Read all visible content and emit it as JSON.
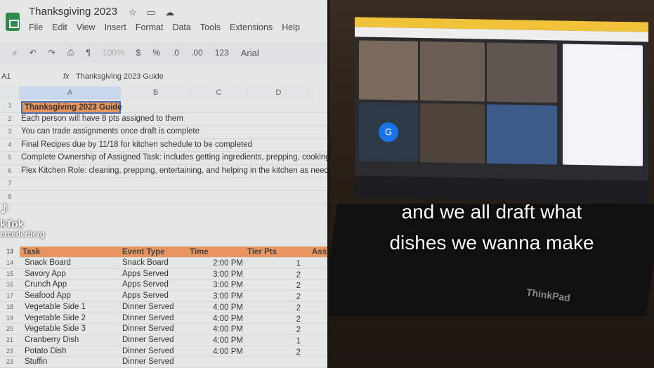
{
  "sheet": {
    "title": "Thanksgiving 2023",
    "menu": [
      "File",
      "Edit",
      "View",
      "Insert",
      "Format",
      "Data",
      "Tools",
      "Extensions",
      "Help"
    ],
    "toolbar": {
      "zoom": "100%",
      "currency": "$",
      "percent": "%",
      "dec_less": ".0",
      "dec_more": ".00",
      "format": "123",
      "font": "Arial"
    },
    "cell_ref": "A1",
    "fx": "fx",
    "formula": "Thanksgiving 2023 Guide",
    "columns": [
      "A",
      "B",
      "C",
      "D"
    ],
    "notes": [
      {
        "row": "1",
        "text": "Thanksgiving 2023 Guide"
      },
      {
        "row": "2",
        "text": "Each person will have 8 pts assigned to them"
      },
      {
        "row": "3",
        "text": "You can trade assignments once draft is complete"
      },
      {
        "row": "4",
        "text": "Final Recipes due by 11/18 for kitchen schedule to be completed"
      },
      {
        "row": "5",
        "text": "Complete Ownership of Assigned Task: includes getting ingredients, prepping, cooking a"
      },
      {
        "row": "6",
        "text": "Flex Kitchen Role: cleaning, prepping, entertaining, and helping in the kitchen as needed"
      },
      {
        "row": "7",
        "text": ""
      },
      {
        "row": "8",
        "text": ""
      }
    ],
    "table_header": {
      "row": "13",
      "cols": [
        "Task",
        "Event Type",
        "Time",
        "Tier Pts",
        "Ass"
      ]
    },
    "table_rows": [
      {
        "row": "14",
        "task": "Snack Board",
        "event": "Snack Board",
        "time": "2:00 PM",
        "pts": "1"
      },
      {
        "row": "15",
        "task": "Savory App",
        "event": "Apps Served",
        "time": "3:00 PM",
        "pts": "2"
      },
      {
        "row": "16",
        "task": "Crunch App",
        "event": "Apps Served",
        "time": "3:00 PM",
        "pts": "2"
      },
      {
        "row": "17",
        "task": "Seafood App",
        "event": "Apps Served",
        "time": "3:00 PM",
        "pts": "2"
      },
      {
        "row": "18",
        "task": "Vegetable Side 1",
        "event": "Dinner Served",
        "time": "4:00 PM",
        "pts": "2"
      },
      {
        "row": "19",
        "task": "Vegetable Side 2",
        "event": "Dinner Served",
        "time": "4:00 PM",
        "pts": "2"
      },
      {
        "row": "20",
        "task": "Vegetable Side 3",
        "event": "Dinner Served",
        "time": "4:00 PM",
        "pts": "2"
      },
      {
        "row": "21",
        "task": "Cranberry Dish",
        "event": "Dinner Served",
        "time": "4:00 PM",
        "pts": "1"
      },
      {
        "row": "22",
        "task": "Potato Dish",
        "event": "Dinner Served",
        "time": "4:00 PM",
        "pts": "2"
      },
      {
        "row": "23",
        "task": "Stuffin",
        "event": "Dinner Served",
        "time": "",
        "pts": ""
      }
    ],
    "header_color": "#e8955f"
  },
  "watermark": {
    "brand": "kTok",
    "user": "crcederberg"
  },
  "laptop": {
    "caption_line1": "and we all draft what",
    "caption_line2": "dishes we wanna make",
    "brand": "ThinkPad",
    "avatar_letter": "G"
  }
}
